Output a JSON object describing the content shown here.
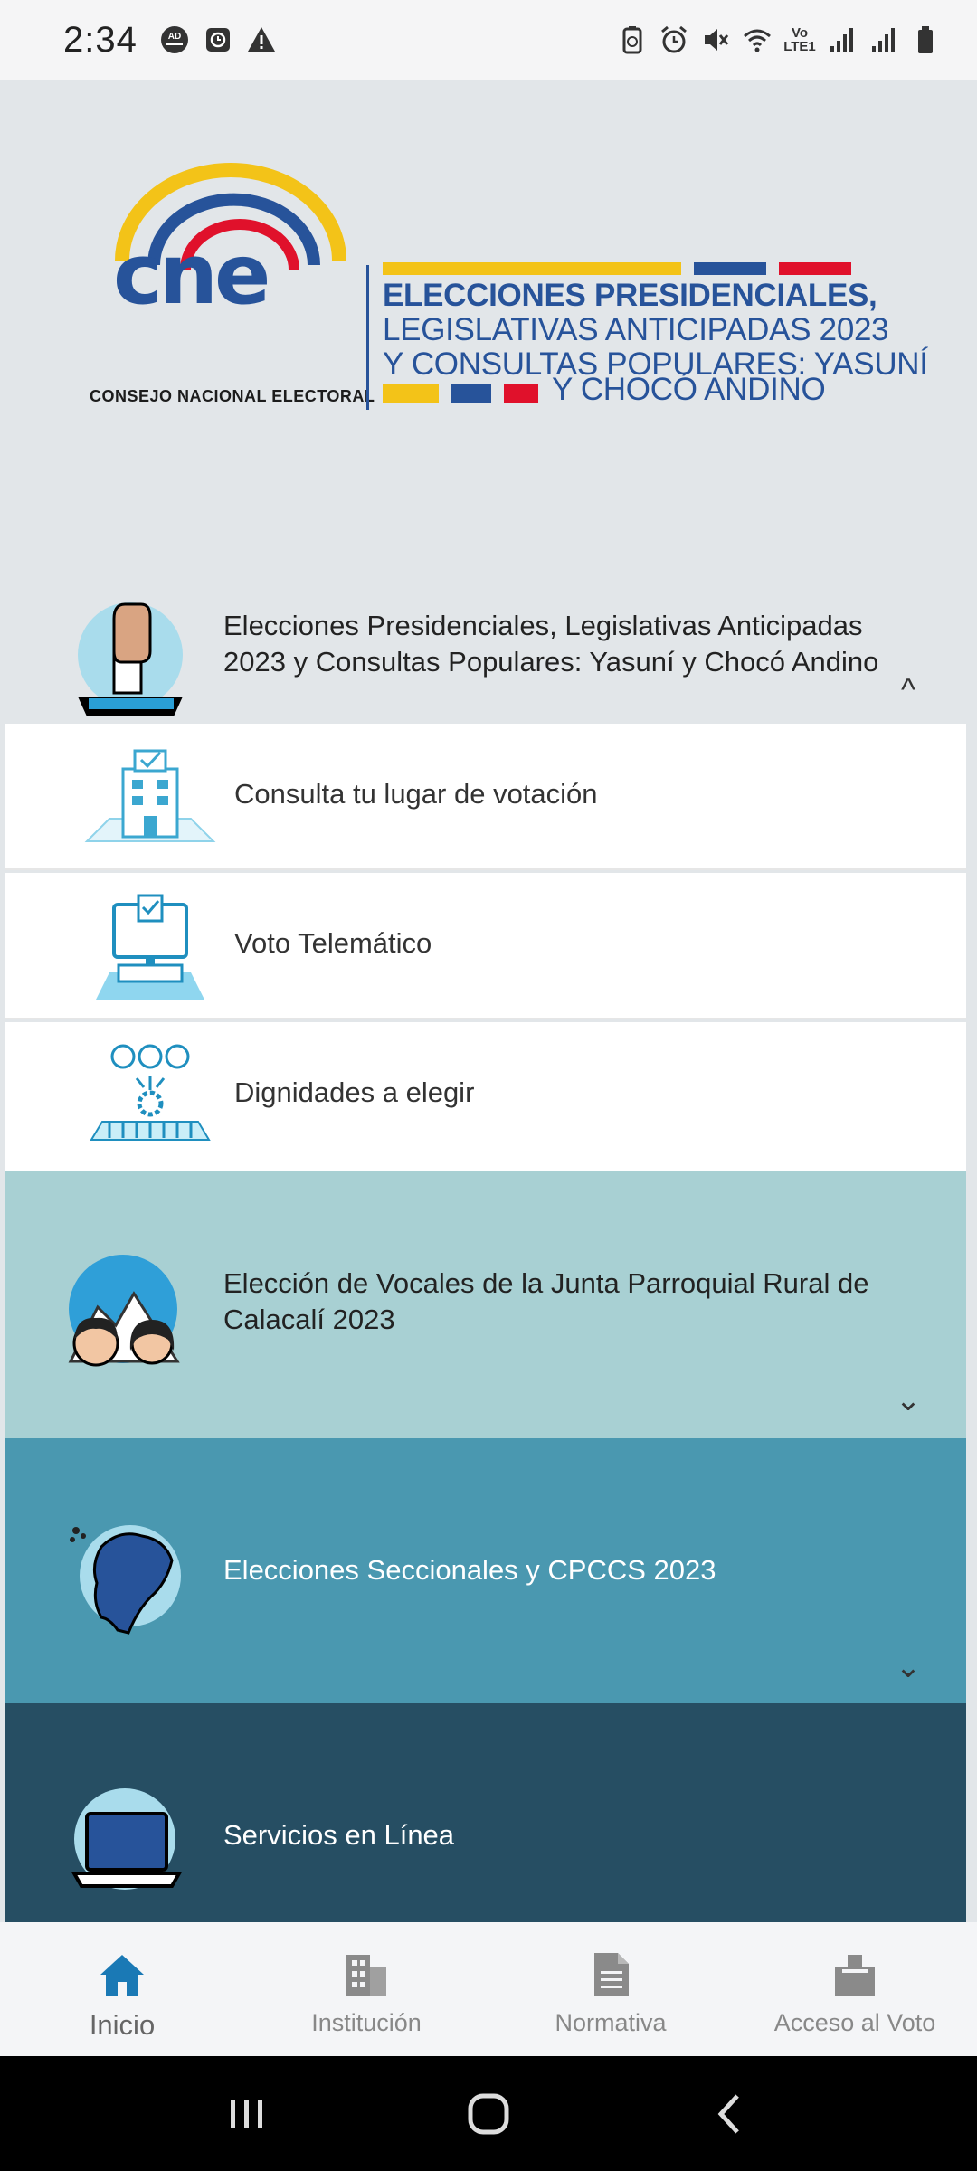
{
  "status_bar": {
    "time": "2:34",
    "network_label_top": "Vo",
    "network_label_bottom": "LTE1"
  },
  "header": {
    "logo_text": "cne",
    "logo_subtitle": "CONSEJO NACIONAL ELECTORAL",
    "banner_lines": [
      "ELECCIONES PRESIDENCIALES,",
      "LEGISLATIVAS ANTICIPADAS 2023",
      "Y CONSULTAS POPULARES: YASUNÍ",
      "Y CHOCÓ ANDINO"
    ]
  },
  "sections": [
    {
      "title": "Elecciones Presidenciales, Legislativas Anticipadas 2023 y Consultas Populares: Yasuní y Chocó Andino",
      "expanded": true,
      "items": [
        {
          "label": "Consulta tu lugar de votación",
          "icon": "polling-place-icon"
        },
        {
          "label": "Voto Telemático",
          "icon": "computer-vote-icon"
        },
        {
          "label": "Dignidades a elegir",
          "icon": "candidates-icon"
        }
      ]
    },
    {
      "title": "Elección de Vocales de la Junta Parroquial Rural de Calacalí 2023",
      "expanded": false,
      "color": "#a8d0d3"
    },
    {
      "title": "Elecciones Seccionales y CPCCS 2023",
      "expanded": false,
      "color": "#4a98b0"
    },
    {
      "title": "Servicios en Línea",
      "expanded": false,
      "color": "#264e63"
    }
  ],
  "bottom_nav": [
    {
      "label": "Inicio",
      "icon": "home-icon",
      "active": true
    },
    {
      "label": "Institución",
      "icon": "building-icon",
      "active": false
    },
    {
      "label": "Normativa",
      "icon": "document-icon",
      "active": false
    },
    {
      "label": "Acceso al Voto",
      "icon": "ballot-box-icon",
      "active": false
    }
  ],
  "colors": {
    "brand_blue": "#27539a",
    "flag_yellow": "#f3c318",
    "flag_red": "#e0112b",
    "nav_active": "#1a79b5",
    "nav_inactive": "#8a8a8a"
  }
}
